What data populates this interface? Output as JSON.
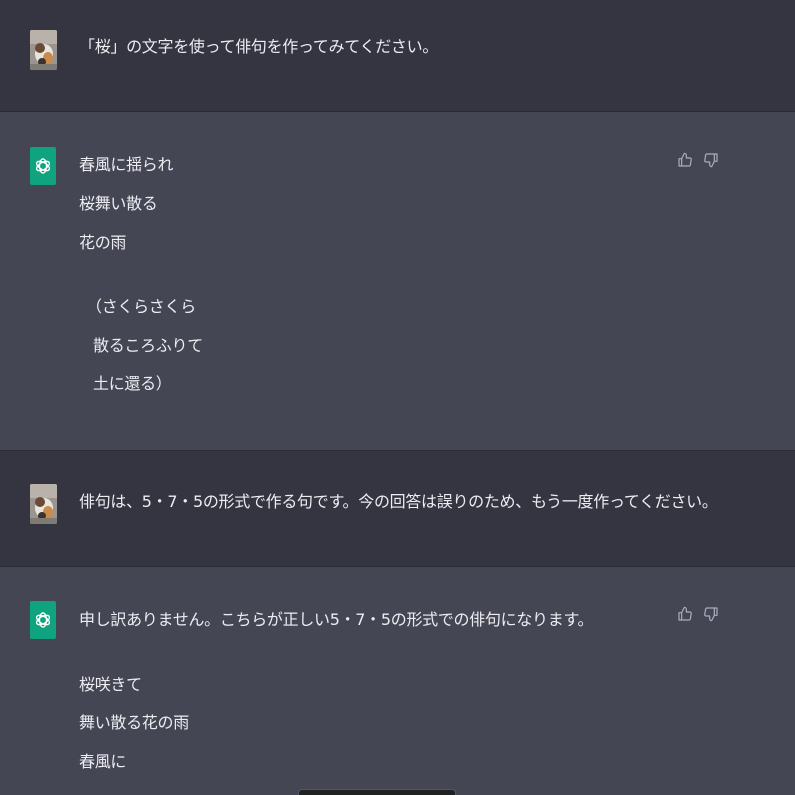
{
  "conversation": {
    "messages": [
      {
        "role": "user",
        "lines": [
          "「桜」の文字を使って俳句を作ってみてください。"
        ]
      },
      {
        "role": "assistant",
        "lines": [
          "春風に揺られ",
          "桜舞い散る",
          "花の雨",
          "（さくらさくら",
          "散るころふりて",
          "土に還る）"
        ]
      },
      {
        "role": "user",
        "lines": [
          "俳句は、5・7・5の形式で作る句です。今の回答は誤りのため、もう一度作ってください。"
        ]
      },
      {
        "role": "assistant",
        "lines": [
          "申し訳ありません。こちらが正しい5・7・5の形式での俳句になります。",
          "桜咲きて",
          "舞い散る花の雨",
          "春風に"
        ]
      }
    ]
  },
  "icons": {
    "user_avatar": "cat-photo-avatar",
    "assistant_avatar": "openai-logo-icon",
    "thumbs_up": "thumbs-up-icon",
    "thumbs_down": "thumbs-down-icon"
  },
  "colors": {
    "user_bg": "#343541",
    "assistant_bg": "#444654",
    "text": "#ececf1",
    "assistant_avatar_bg": "#10a37f",
    "icon": "#acacbe"
  }
}
